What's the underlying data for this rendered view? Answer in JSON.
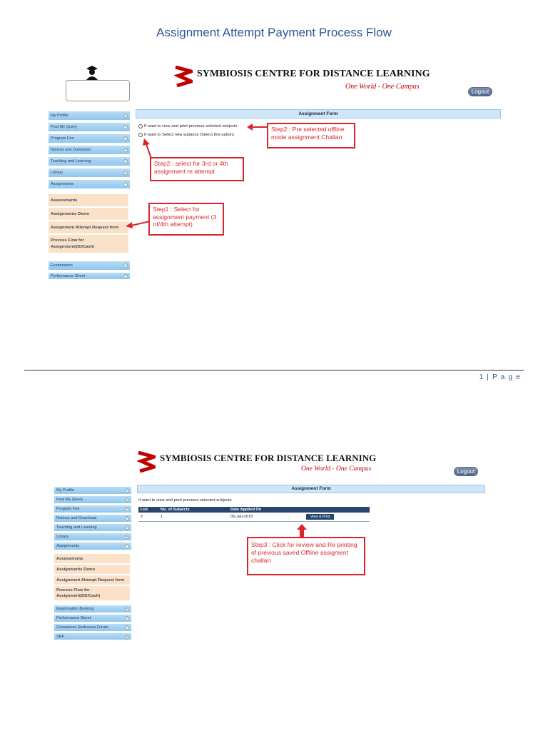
{
  "doc": {
    "title": "Assignment Attempt Payment Process Flow",
    "page_footer": "1 | P a g e"
  },
  "header": {
    "brand": "SYMBIOSIS CENTRE FOR DISTANCE LEARNING",
    "tagline": "One World - One Campus",
    "logout_label": "Logout"
  },
  "sidebar1": {
    "items": [
      "My Profile",
      "Post My Query",
      "Program Fee",
      "Notices and Download",
      "Teaching and Learning",
      "Library",
      "Assignments"
    ],
    "sub_items": [
      "Assessments",
      "Assignments Demo",
      "Assignment Attempt Request form",
      "Process Flow for Assignment(DD/Cash)"
    ],
    "bottom_items": [
      "Examination",
      "Performance Sheet"
    ]
  },
  "form1": {
    "heading": "Assignment Form",
    "option_view": "If want to view and print previous selected subjects",
    "option_new": "If want to Select new subjects (Select this option)"
  },
  "callouts1": {
    "step2_offline": "Step2 : Pre selected offline mode assignment Challan",
    "step2_select": "Step2 :  select for 3rd  or 4th assignment re attempt",
    "step1": "Step1 : Select for assignment payment (3 rd/4th attempt)"
  },
  "sidebar2": {
    "items": [
      "My Profile",
      "Post My Query",
      "Program Fee",
      "Notices and Download",
      "Teaching and Learning",
      "Library",
      "Assignments"
    ],
    "sub_items": [
      "Assessments",
      "Assignments Demo",
      "Assignment Attempt Request form",
      "Process Flow for Assignment(DD/Cash)"
    ],
    "bottom_items": [
      "Examination Booking",
      "Performance Sheet",
      "Grievances Redressal Forum",
      "SRF"
    ]
  },
  "form2": {
    "heading": "Assignment Form",
    "intro": "If want to view and print previous selected subjects",
    "columns": [
      "List",
      "No. of Subjects",
      "Date Applied On",
      ""
    ],
    "rows": [
      {
        "list": "2",
        "subjects": "1",
        "date": "05-Jan-2015",
        "action": "View & Print"
      }
    ]
  },
  "callouts2": {
    "step3": "Step3 : Click for review and Re printing of previous saved Offline assigment challan"
  },
  "colors": {
    "accent": "#2f5597",
    "callout": "#d9262c",
    "nav": "#8fc6ee",
    "sub": "#fbe1c7"
  }
}
